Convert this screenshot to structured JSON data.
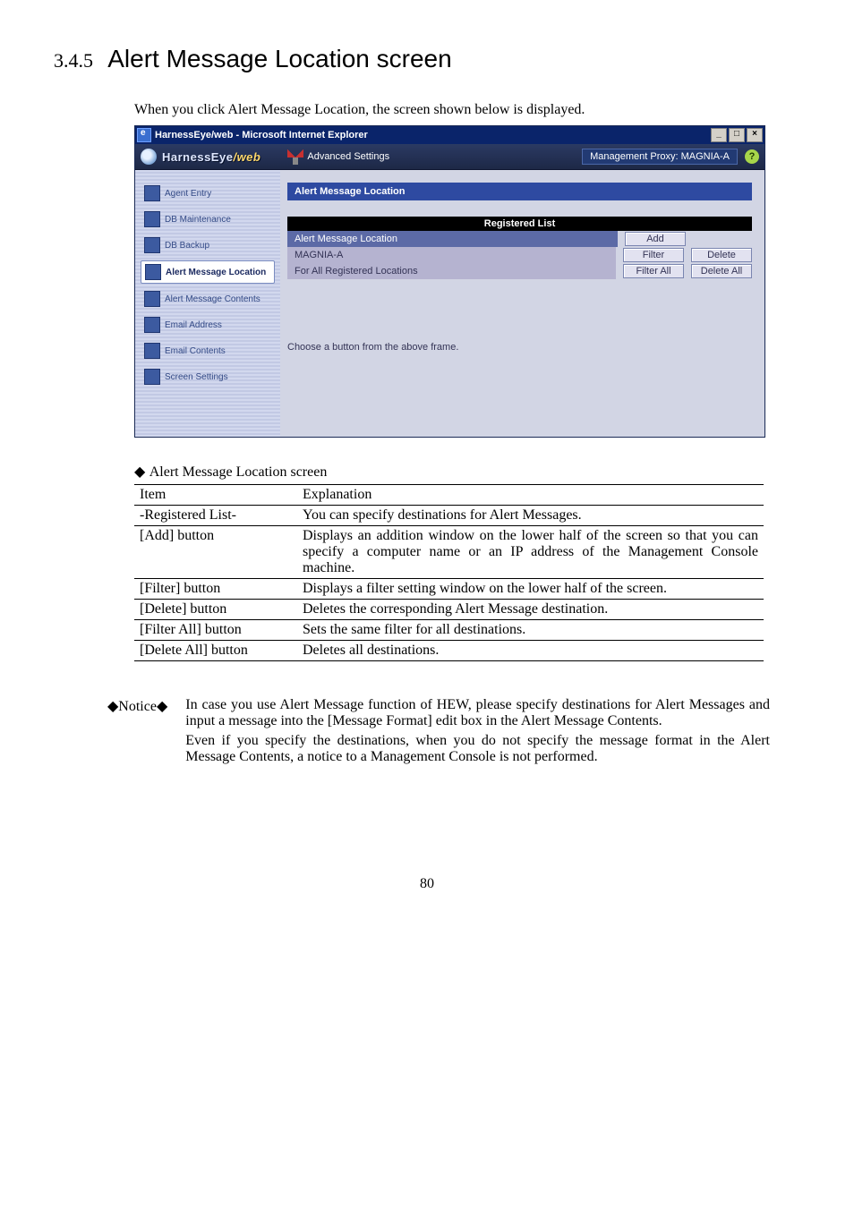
{
  "heading": {
    "number": "3.4.5",
    "title": "Alert Message Location screen"
  },
  "intro": "When you click Alert Message Location, the screen shown below is displayed.",
  "window": {
    "title": "HarnessEye/web - Microsoft Internet Explorer",
    "brand_main": "HarnessEye",
    "brand_web": "/web",
    "advanced": "Advanced Settings",
    "mgmt_proxy": "Management Proxy: MAGNIA-A",
    "help": "?",
    "sidebar": [
      "Agent Entry",
      "DB Maintenance",
      "DB Backup",
      "Alert Message Location",
      "Alert Message Contents",
      "Email Address",
      "Email Contents",
      "Screen Settings"
    ],
    "panel_title": "Alert Message Location",
    "registered_list": "Registered List",
    "col_header": "Alert Message Location",
    "row1_cell": "MAGNIA-A",
    "row2_cell": "For All Registered Locations",
    "btn_add": "Add",
    "btn_filter": "Filter",
    "btn_delete": "Delete",
    "btn_filter_all": "Filter All",
    "btn_delete_all": "Delete All",
    "bottom_msg": "Choose a button from the above frame."
  },
  "table_caption": "Alert Message Location screen",
  "table_head": {
    "item": "Item",
    "explanation": "Explanation"
  },
  "table_rows": [
    {
      "item": "-Registered List-",
      "exp": "You can specify destinations for Alert Messages."
    },
    {
      "item": "[Add] button",
      "exp": "Displays an addition window on the lower half of the screen so that you can specify a computer name or an IP address of the Management Console machine."
    },
    {
      "item": "[Filter] button",
      "exp": "Displays a filter setting window on the lower half of the screen."
    },
    {
      "item": "[Delete] button",
      "exp": "Deletes the corresponding Alert Message destination."
    },
    {
      "item": "[Filter All] button",
      "exp": "Sets the same filter for all destinations."
    },
    {
      "item": "[Delete All] button",
      "exp": "Deletes all destinations."
    }
  ],
  "notice": {
    "label": "◆Notice◆",
    "p1": "In case you use Alert Message function of HEW, please specify destinations for Alert Messages and input a message into the [Message Format] edit box in the Alert Message Contents.",
    "p2": "Even if you specify the destinations, when you do not specify the message format in the Alert Message Contents, a notice to a Management Console is not performed."
  },
  "page_number": "80"
}
